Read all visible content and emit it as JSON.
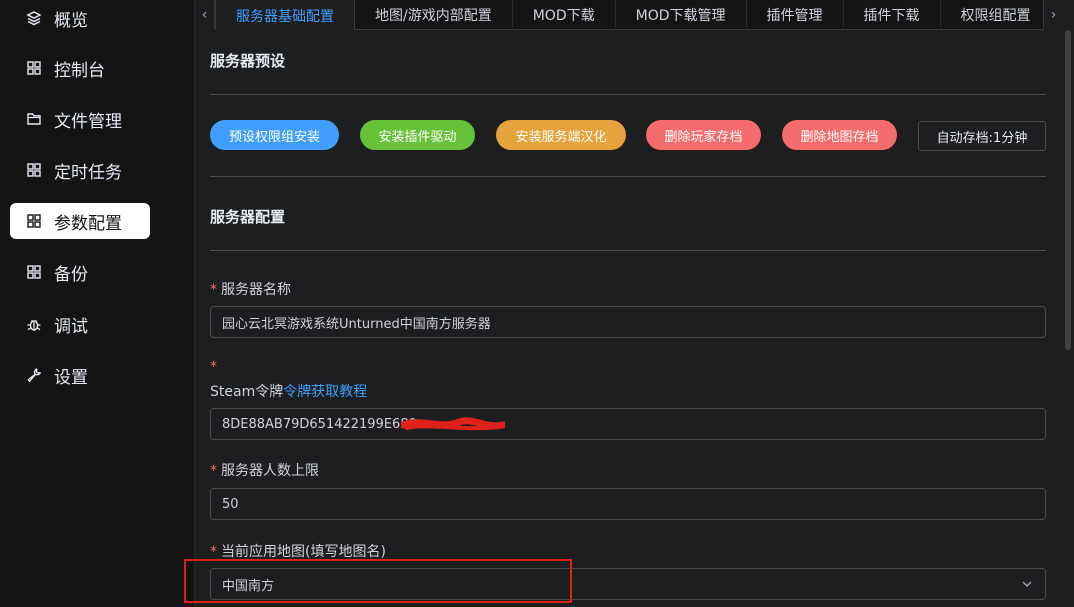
{
  "sidebar": {
    "items": [
      {
        "label": "概览",
        "icon": "layers-icon",
        "active": false
      },
      {
        "label": "控制台",
        "icon": "grid-icon",
        "active": false
      },
      {
        "label": "文件管理",
        "icon": "folder-icon",
        "active": false
      },
      {
        "label": "定时任务",
        "icon": "grid-icon",
        "active": false
      },
      {
        "label": "参数配置",
        "icon": "grid-icon",
        "active": true
      },
      {
        "label": "备份",
        "icon": "grid-icon",
        "active": false
      },
      {
        "label": "调试",
        "icon": "bug-icon",
        "active": false
      },
      {
        "label": "设置",
        "icon": "wrench-icon",
        "active": false
      }
    ]
  },
  "tabs": {
    "prev": "‹",
    "next": "›",
    "items": [
      {
        "label": "服务器基础配置",
        "active": true
      },
      {
        "label": "地图/游戏内部配置",
        "active": false
      },
      {
        "label": "MOD下载",
        "active": false
      },
      {
        "label": "MOD下载管理",
        "active": false
      },
      {
        "label": "插件管理",
        "active": false
      },
      {
        "label": "插件下载",
        "active": false
      },
      {
        "label": "权限组配置",
        "active": false
      }
    ]
  },
  "preset": {
    "title": "服务器预设",
    "buttons": [
      {
        "label": "预设权限组安装",
        "color": "#409eff"
      },
      {
        "label": "安装插件驱动",
        "color": "#67c23a"
      },
      {
        "label": "安装服务端汉化",
        "color": "#e6a23c"
      },
      {
        "label": "删除玩家存档",
        "color": "#f56c6c"
      },
      {
        "label": "删除地图存档",
        "color": "#f56c6c"
      }
    ],
    "autosave": "自动存档:1分钟"
  },
  "config": {
    "title": "服务器配置",
    "required_mark": "*",
    "server_name": {
      "label": "服务器名称",
      "value": "园心云北冥游戏系统Unturned中国南方服务器"
    },
    "steam_token": {
      "label": "Steam令牌",
      "link": "令牌获取教程",
      "value": "8DE88AB79D651422199E689"
    },
    "max_players": {
      "label": "服务器人数上限",
      "value": "50"
    },
    "current_map": {
      "label": "当前应用地图(填写地图名)",
      "value": "中国南方"
    }
  },
  "colors": {
    "accent": "#409eff",
    "required": "#f56c6c",
    "highlight": "#e0201b",
    "redaction": "#e0201b"
  }
}
